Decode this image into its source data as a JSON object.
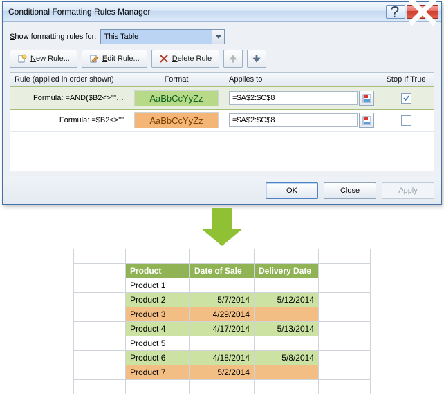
{
  "dialog": {
    "title": "Conditional Formatting Rules Manager",
    "show_label_pre": "S",
    "show_label_post": "how formatting rules for:",
    "scope_value": "This Table",
    "toolbar": {
      "new_pre": "N",
      "new_post": "ew Rule...",
      "edit_pre": "E",
      "edit_post": "dit Rule...",
      "delete_pre": "D",
      "delete_post": "elete Rule"
    },
    "headers": {
      "rule": "Rule (applied in order shown)",
      "format": "Format",
      "applies": "Applies to",
      "stop": "Stop If True"
    },
    "rules": [
      {
        "formula": "Formula: =AND($B2<>\"\"…",
        "sample": "AaBbCcYyZz",
        "applies": "=$A$2:$C$8",
        "stop": true,
        "color": "green",
        "selected": true
      },
      {
        "formula": "Formula: =$B2<>\"\"",
        "sample": "AaBbCcYyZz",
        "applies": "=$A$2:$C$8",
        "stop": false,
        "color": "orange",
        "selected": false
      }
    ],
    "buttons": {
      "ok": "OK",
      "close": "Close",
      "apply": "Apply"
    }
  },
  "sheet": {
    "headers": [
      "Product",
      "Date of Sale",
      "Delivery Date"
    ],
    "rows": [
      {
        "cells": [
          "Product 1",
          "",
          ""
        ],
        "style": "plain"
      },
      {
        "cells": [
          "Product 2",
          "5/7/2014",
          "5/12/2014"
        ],
        "style": "green"
      },
      {
        "cells": [
          "Product 3",
          "4/29/2014",
          ""
        ],
        "style": "orange"
      },
      {
        "cells": [
          "Product 4",
          "4/17/2014",
          "5/13/2014"
        ],
        "style": "green"
      },
      {
        "cells": [
          "Product 5",
          "",
          ""
        ],
        "style": "plain"
      },
      {
        "cells": [
          "Product 6",
          "4/18/2014",
          "5/8/2014"
        ],
        "style": "green"
      },
      {
        "cells": [
          "Product 7",
          "5/2/2014",
          ""
        ],
        "style": "orange"
      }
    ]
  },
  "chart_data": {
    "type": "table",
    "title": "Conditional formatting sample data",
    "columns": [
      "Product",
      "Date of Sale",
      "Delivery Date"
    ],
    "rows": [
      [
        "Product 1",
        null,
        null
      ],
      [
        "Product 2",
        "5/7/2014",
        "5/12/2014"
      ],
      [
        "Product 3",
        "4/29/2014",
        null
      ],
      [
        "Product 4",
        "4/17/2014",
        "5/13/2014"
      ],
      [
        "Product 5",
        null,
        null
      ],
      [
        "Product 6",
        "4/18/2014",
        "5/8/2014"
      ],
      [
        "Product 7",
        "5/2/2014",
        null
      ]
    ]
  }
}
